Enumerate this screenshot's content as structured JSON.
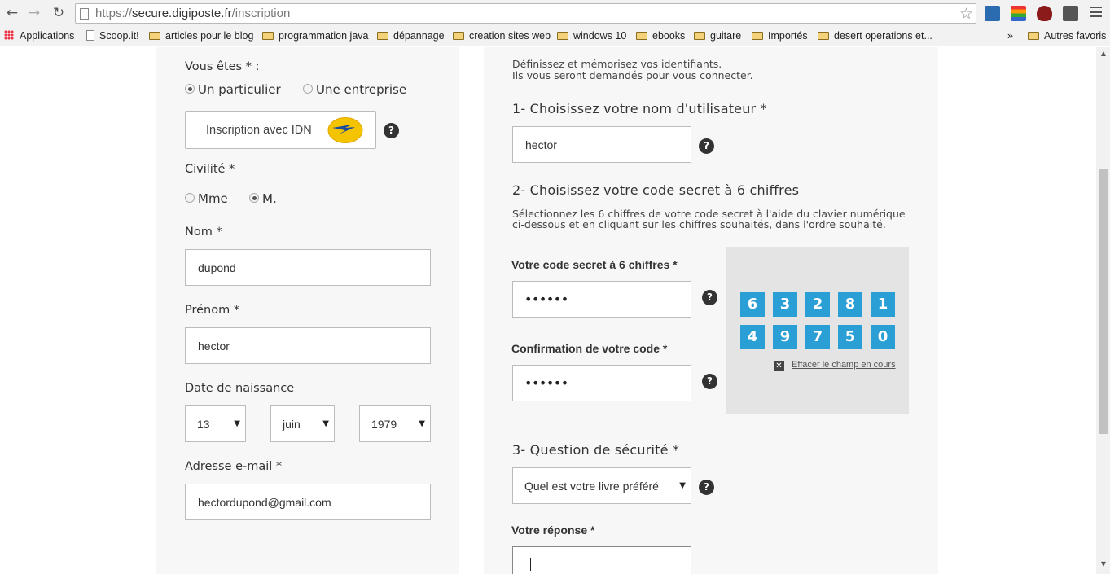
{
  "browser": {
    "url_prefix": "https://",
    "url_host": "secure.digiposte.fr",
    "url_path": "/inscription",
    "bookmarks": [
      "Applications",
      "Scoop.it!",
      "articles pour le blog",
      "programmation java",
      "dépannage",
      "creation sites web",
      "windows 10",
      "ebooks",
      "guitare",
      "Importés",
      "desert operations et...",
      "Autres favoris"
    ],
    "overflow": "»"
  },
  "left_form": {
    "vous_etes_label": "Vous êtes * :",
    "radio_particulier": "Un particulier",
    "radio_entreprise": "Une entreprise",
    "idn_button": "Inscription avec IDN",
    "civilite_label": "Civilité *",
    "radio_mme": "Mme",
    "radio_m": "M.",
    "nom_label": "Nom *",
    "nom_value": "dupond",
    "prenom_label": "Prénom *",
    "prenom_value": "hector",
    "dob_label": "Date de naissance",
    "dob_day": "13",
    "dob_month": "juin",
    "dob_year": "1979",
    "email_label": "Adresse e-mail *",
    "email_value": "hectordupond@gmail.com"
  },
  "right_form": {
    "intro_line1": "Définissez et mémorisez vos identifiants.",
    "intro_line2": "Ils vous seront demandés pour vous connecter.",
    "step1_title": "1- Choisissez votre nom d'utilisateur *",
    "username_value": "hector",
    "step2_title": "2- Choisissez votre code secret à 6 chiffres",
    "step2_help_line1": "Sélectionnez les 6 chiffres de votre code secret à l'aide du clavier numérique",
    "step2_help_line2": "ci-dessous et en cliquant sur les chiffres souhaités, dans l'ordre souhaité.",
    "code_label": "Votre code secret à 6 chiffres *",
    "code_masked": "••••••",
    "confirm_label": "Confirmation de votre code *",
    "confirm_masked": "••••••",
    "keypad_keys": [
      "6",
      "3",
      "2",
      "8",
      "1",
      "4",
      "9",
      "7",
      "5",
      "0"
    ],
    "clear_link": "Effacer le champ en cours",
    "step3_title": "3- Question de sécurité *",
    "question_value": "Quel est votre livre préféré",
    "answer_label": "Votre réponse *",
    "help_glyph": "?"
  },
  "colors": {
    "keypad_key": "#2a9fd6",
    "panel_bg": "#f7f7f7",
    "help_icon": "#333333"
  }
}
